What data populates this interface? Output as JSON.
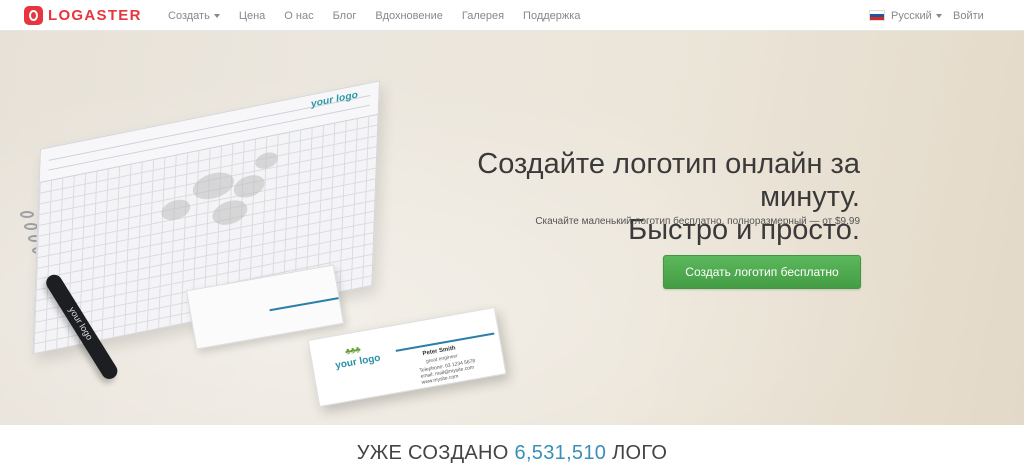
{
  "brand": {
    "name": "LOGASTER",
    "color": "#e8343f"
  },
  "nav": {
    "items": [
      {
        "label": "Создать",
        "dropdown": true
      },
      {
        "label": "Цена",
        "dropdown": false
      },
      {
        "label": "О нас",
        "dropdown": false
      },
      {
        "label": "Блог",
        "dropdown": false
      },
      {
        "label": "Вдохновение",
        "dropdown": false
      },
      {
        "label": "Галерея",
        "dropdown": false
      },
      {
        "label": "Поддержка",
        "dropdown": false
      }
    ],
    "language": "Русский",
    "login": "Войти"
  },
  "hero": {
    "headline_line1": "Создайте логотип онлайн за минуту.",
    "headline_line2": "Быстро и просто.",
    "subline": "Скачайте маленький логотип бесплатно, полноразмерный — от $9.99",
    "cta": "Создать логотип бесплатно",
    "cta_color": "#4cae4c",
    "mockup": {
      "notebook_logo": "your logo",
      "pen_text": "your logo",
      "card_logo": "your logo",
      "card_name": "Peter Smith",
      "card_title": "great engineer",
      "card_phone": "Telephone: 03 1234 5678",
      "card_email": "email: mail@mysite.com",
      "card_site": "www.mysite.com"
    }
  },
  "counter": {
    "prefix": "УЖЕ СОЗДАНО",
    "value": "6,531,510",
    "suffix": "ЛОГО",
    "accent": "#3a8fb7"
  }
}
